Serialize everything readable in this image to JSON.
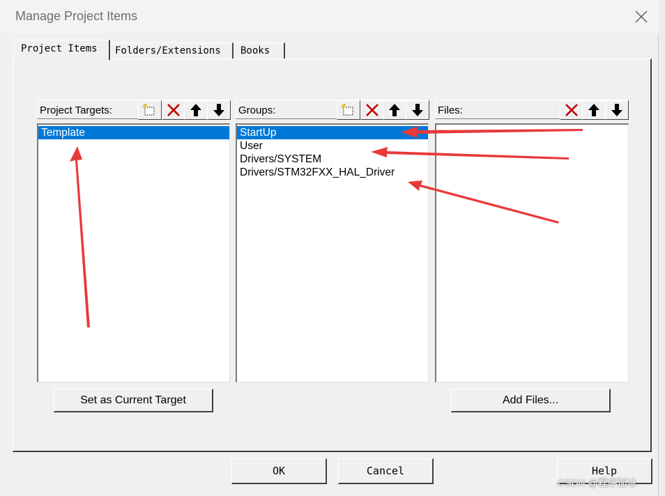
{
  "window": {
    "title": "Manage Project Items"
  },
  "tabs": [
    {
      "label": "Project Items",
      "active": true
    },
    {
      "label": "Folders/Extensions",
      "active": false
    },
    {
      "label": "Books",
      "active": false
    }
  ],
  "targets_panel": {
    "label": "Project Targets:",
    "items": [
      {
        "label": "Template",
        "selected": true
      }
    ],
    "action_label": "Set as Current Target"
  },
  "groups_panel": {
    "label": "Groups:",
    "items": [
      {
        "label": "StartUp",
        "selected": true
      },
      {
        "label": "User",
        "selected": false
      },
      {
        "label": "Drivers/SYSTEM",
        "selected": false
      },
      {
        "label": "Drivers/STM32FXX_HAL_Driver",
        "selected": false
      }
    ]
  },
  "files_panel": {
    "label": "Files:",
    "items": [],
    "action_label": "Add Files..."
  },
  "footer": {
    "ok_label": "OK",
    "cancel_label": "Cancel",
    "help_label": "Help"
  },
  "watermark": "CSDN @程序加冰",
  "colors": {
    "selection": "#0078d7",
    "delete_icon": "#c00000",
    "annotation_arrow": "#e8393a"
  },
  "icons": {
    "new": "new-item-icon",
    "delete": "delete-x-icon",
    "move_up": "arrow-up-icon",
    "move_down": "arrow-down-icon",
    "close": "close-icon"
  }
}
